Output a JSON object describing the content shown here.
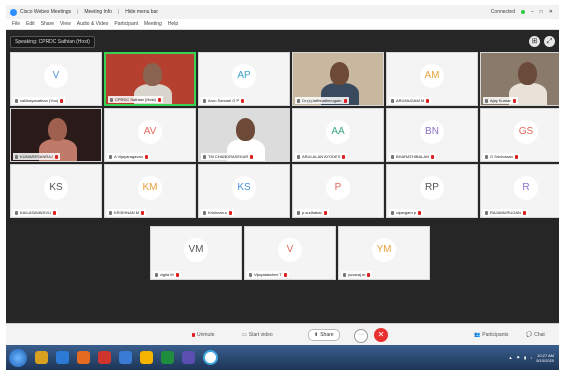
{
  "window": {
    "app_title": "Cisco Webex Meetings",
    "tab1": "Meeting Info",
    "tab2": "Hide menu bar",
    "connection": "Connected",
    "controls": [
      "–",
      "□",
      "✕"
    ]
  },
  "menu": [
    "File",
    "Edit",
    "Share",
    "View",
    "Audio & Video",
    "Participant",
    "Meeting",
    "Help"
  ],
  "speaking": "Speaking: CPRDC Sathian (Host)",
  "participants": [
    {
      "initials": "V",
      "name": "vallinayanathan (You)",
      "color": "#4a90d9",
      "kind": "avatar"
    },
    {
      "initials": "",
      "name": "CPRDC Sathian (Host)",
      "kind": "video",
      "active": true
    },
    {
      "initials": "AP",
      "name": "Arun Samuel G P",
      "color": "#3aa3c9",
      "kind": "avatar"
    },
    {
      "initials": "",
      "name": "Dr.(s)Jaffrinathmugam",
      "kind": "video"
    },
    {
      "initials": "AM",
      "name": "ARUMUGAM M",
      "color": "#e6a23c",
      "kind": "avatar"
    },
    {
      "initials": "",
      "name": "Ajay Kumar",
      "kind": "video"
    },
    {
      "initials": "",
      "name": "KUMARESANRAJ",
      "kind": "video"
    },
    {
      "initials": "AV",
      "name": "A Vijayaragavan",
      "color": "#e0675d",
      "kind": "avatar"
    },
    {
      "initials": "",
      "name": "TM CHANDRASEKAR",
      "kind": "video"
    },
    {
      "initials": "AA",
      "name": "ARULALAN AYODES",
      "color": "#3aa77f",
      "kind": "avatar"
    },
    {
      "initials": "BN",
      "name": "BHARATHIBALAN",
      "color": "#8d6fc7",
      "kind": "avatar"
    },
    {
      "initials": "GS",
      "name": "G Srinivasan",
      "color": "#e0675d",
      "kind": "avatar"
    },
    {
      "initials": "KS",
      "name": "KAILASAVADIVU",
      "color": "#555555",
      "kind": "avatar"
    },
    {
      "initials": "KM",
      "name": "KRISHNAN M",
      "color": "#e6a23c",
      "kind": "avatar"
    },
    {
      "initials": "KS",
      "name": "Krishnan.s",
      "color": "#4a90d9",
      "kind": "avatar"
    },
    {
      "initials": "P",
      "name": "p.sudhakar",
      "color": "#e0675d",
      "kind": "avatar"
    },
    {
      "initials": "RP",
      "name": "rajangam p",
      "color": "#555555",
      "kind": "avatar"
    },
    {
      "initials": "R",
      "name": "RAJAMURUGAN",
      "color": "#8d6fc7",
      "kind": "avatar"
    },
    {
      "initials": "VM",
      "name": "vigila M",
      "color": "#555555",
      "kind": "avatar"
    },
    {
      "initials": "V",
      "name": "Vijayalakshmi T",
      "color": "#e0675d",
      "kind": "avatar"
    },
    {
      "initials": "YM",
      "name": "yuvaraj.m",
      "color": "#e6a23c",
      "kind": "avatar"
    }
  ],
  "toolbar": {
    "unmute": "Unmute",
    "start_video": "Start video",
    "share": "Share",
    "more": "···",
    "end": "✕",
    "participants": "Participants",
    "chat": "Chat"
  },
  "taskbar": {
    "time": "10:27 AM",
    "date": "5/10/2020",
    "tray_icons": [
      "network-icon",
      "volume-icon",
      "flag-icon"
    ]
  },
  "colors": {
    "active_border": "#39d353",
    "end_button": "#e8312f",
    "stage_bg": "#262626"
  }
}
